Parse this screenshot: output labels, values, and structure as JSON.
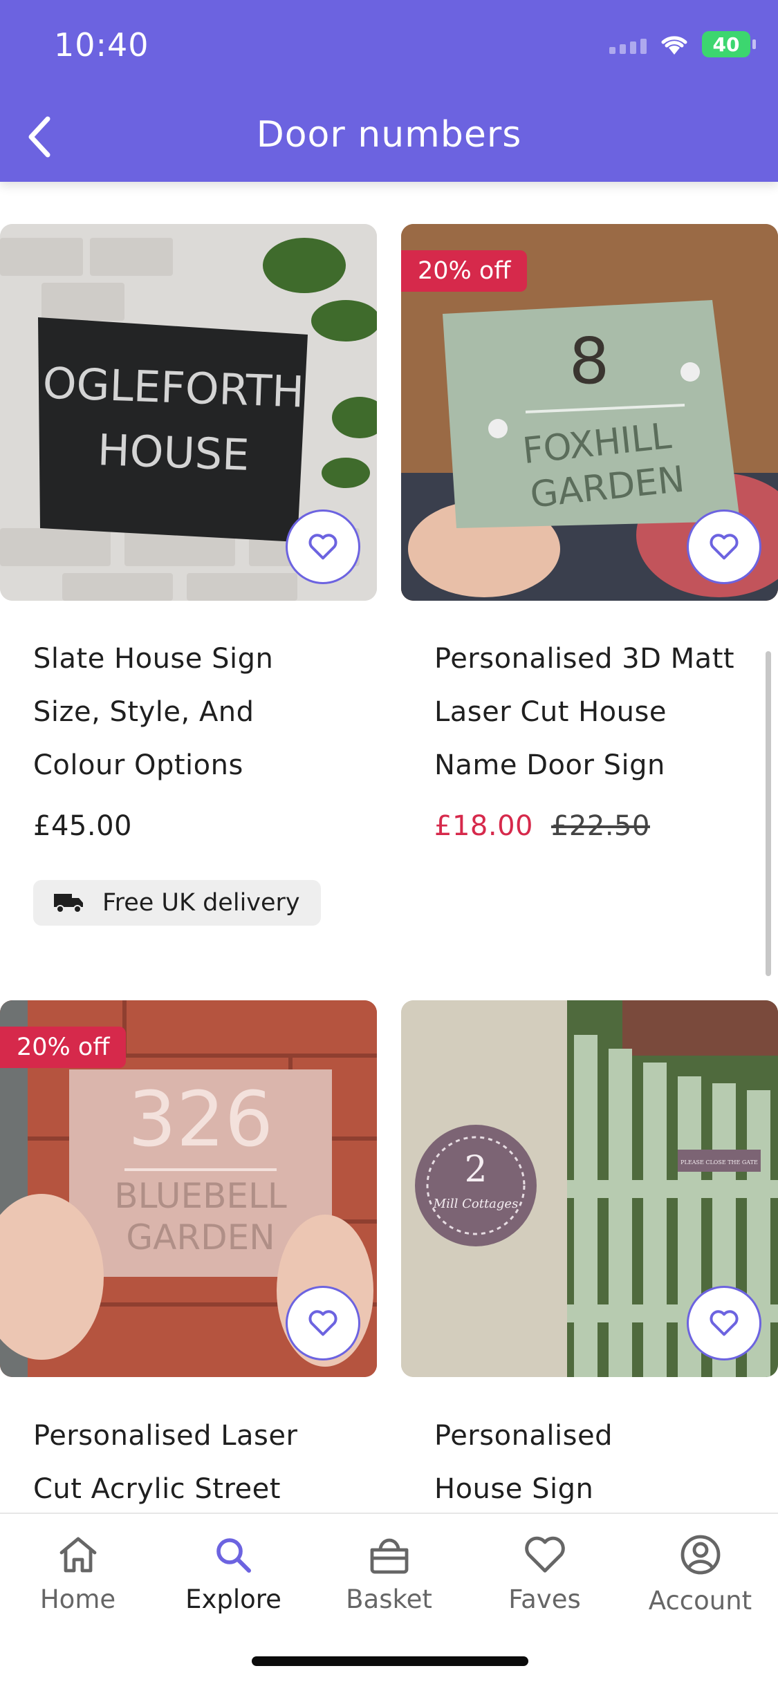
{
  "status_bar": {
    "time": "10:40",
    "battery": "40"
  },
  "header": {
    "title": "Door numbers",
    "back_icon": "chevron-left-icon"
  },
  "products": [
    {
      "name_lines": [
        "Slate House Sign",
        "Size, Style, And",
        "Colour Options"
      ],
      "price": "£45.00",
      "delivery": "Free UK delivery",
      "image_text": [
        "OGLEFORTH",
        "HOUSE"
      ]
    },
    {
      "badge": "20% off",
      "name_lines": [
        "Personalised 3D Matt",
        "Laser Cut House",
        "Name Door Sign"
      ],
      "sale_price": "£18.00",
      "old_price": "£22.50",
      "image_text": [
        "8",
        "FOXHILL",
        "GARDEN"
      ]
    },
    {
      "badge": "20% off",
      "name_lines": [
        "Personalised Laser",
        "Cut Acrylic Street"
      ],
      "image_text": [
        "326",
        "BLUEBELL",
        "GARDEN"
      ]
    },
    {
      "name_lines": [
        "Personalised",
        "House Sign"
      ],
      "image_text": [
        "2",
        "Mill Cottages",
        "PLEASE CLOSE THE GATE"
      ]
    }
  ],
  "bottom_nav": [
    {
      "label": "Home",
      "icon": "home-icon"
    },
    {
      "label": "Explore",
      "icon": "search-icon",
      "active": true
    },
    {
      "label": "Basket",
      "icon": "basket-icon"
    },
    {
      "label": "Faves",
      "icon": "heart-icon"
    },
    {
      "label": "Account",
      "icon": "account-icon"
    }
  ],
  "colors": {
    "brand": "#6c63e0",
    "sale": "#d6294b"
  }
}
